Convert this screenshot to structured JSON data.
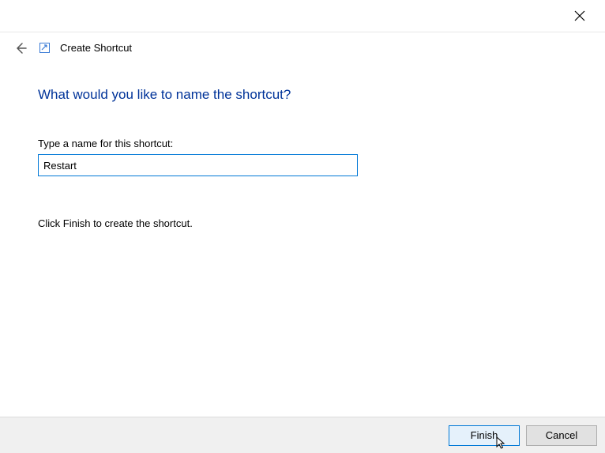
{
  "window": {
    "wizard_title": "Create Shortcut"
  },
  "main": {
    "heading": "What would you like to name the shortcut?",
    "field_label": "Type a name for this shortcut:",
    "name_value": "Restart",
    "hint": "Click Finish to create the shortcut."
  },
  "footer": {
    "finish_label": "Finish",
    "cancel_label": "Cancel"
  }
}
